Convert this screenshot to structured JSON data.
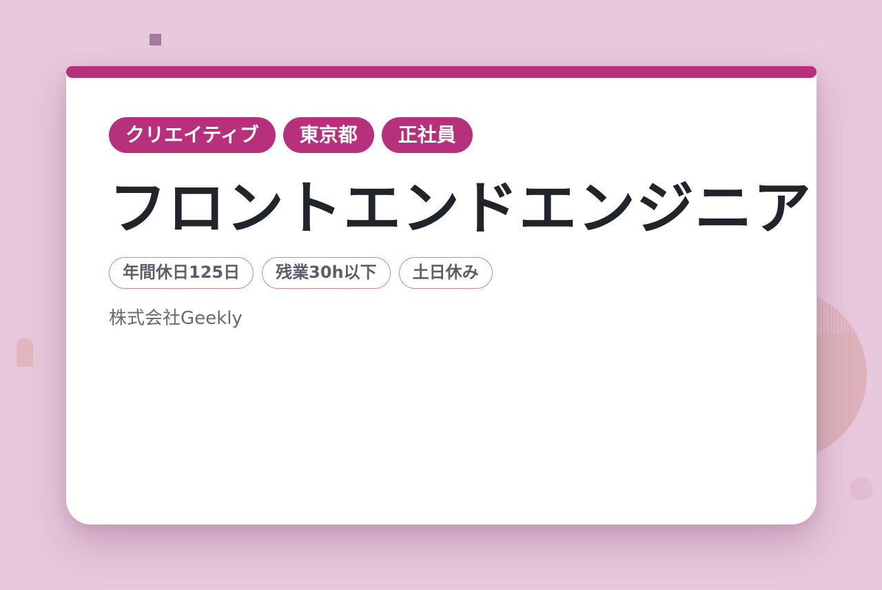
{
  "colors": {
    "background": "#e8c8dd",
    "accent": "#b6307c",
    "title": "#22242c",
    "muted_text": "#5c5f6b",
    "condition_border": "#d77fac",
    "card": "#ffffff"
  },
  "job": {
    "tags": [
      "クリエイティブ",
      "東京都",
      "正社員"
    ],
    "title": "フロントエンドエンジニア",
    "conditions": [
      "年間休日125日",
      "残業30h以下",
      "土日休み"
    ],
    "company": "株式会社Geekly"
  }
}
